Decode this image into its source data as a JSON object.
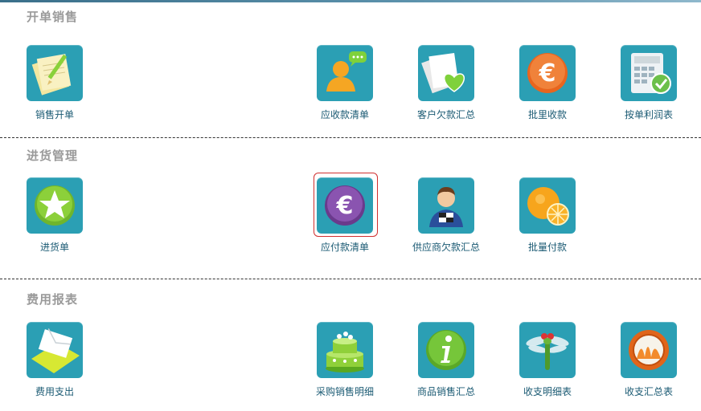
{
  "sections": [
    {
      "title": "开单销售",
      "items": [
        {
          "label": "销售开单",
          "icon": "notepad-pencil-icon"
        },
        {
          "label": "应收款清单",
          "icon": "user-chat-icon"
        },
        {
          "label": "客户欠款汇总",
          "icon": "papers-heart-icon"
        },
        {
          "label": "批里收款",
          "icon": "euro-coin-orange-icon"
        },
        {
          "label": "按单利润表",
          "icon": "calculator-check-icon"
        }
      ]
    },
    {
      "title": "进货管理",
      "items": [
        {
          "label": "进货单",
          "icon": "green-star-icon"
        },
        {
          "label": "应付款清单",
          "icon": "euro-coin-purple-icon",
          "selected": true
        },
        {
          "label": "供应商欠款汇总",
          "icon": "supplier-person-icon"
        },
        {
          "label": "批量付款",
          "icon": "oranges-icon"
        }
      ]
    },
    {
      "title": "费用报表",
      "items": [
        {
          "label": "费用支出",
          "icon": "envelope-icon"
        },
        {
          "label": "采购销售明细",
          "icon": "cake-icon"
        },
        {
          "label": "商品销售汇总",
          "icon": "info-green-icon"
        },
        {
          "label": "收支明细表",
          "icon": "dragonfly-icon"
        },
        {
          "label": "收支汇总表",
          "icon": "orange-ring-icon"
        }
      ]
    }
  ],
  "colors": {
    "tile_bg": "#2b9fb4",
    "label": "#1a5a73",
    "section_title": "#9a9a9a",
    "selection": "#d03030"
  }
}
